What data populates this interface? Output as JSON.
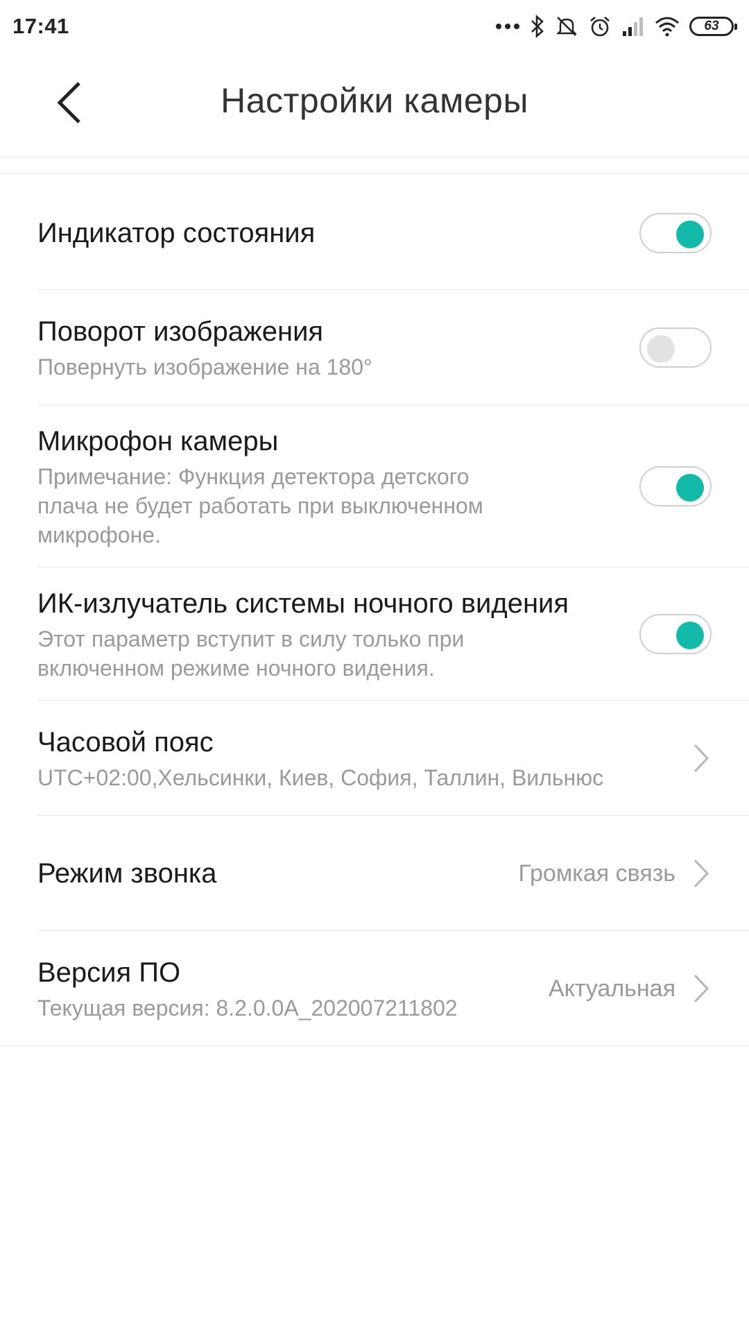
{
  "status_bar": {
    "time": "17:41",
    "battery_level": "63",
    "icons": [
      "more-dots-icon",
      "bluetooth-icon",
      "mute-icon",
      "alarm-icon",
      "signal-icon",
      "wifi-icon",
      "battery-icon"
    ]
  },
  "header": {
    "title": "Настройки камеры",
    "back_icon": "chevron-left-icon"
  },
  "colors": {
    "accent": "#13b9a9",
    "toggle_off_knob": "#e2e2e2",
    "subtitle": "#9a9a9a"
  },
  "settings": {
    "status_indicator": {
      "title": "Индикатор состояния",
      "enabled": true
    },
    "image_rotation": {
      "title": "Поворот изображения",
      "subtitle": "Повернуть изображение на 180°",
      "enabled": false
    },
    "camera_mic": {
      "title": "Микрофон камеры",
      "subtitle_line1": "Примечание: Функция детектора детского",
      "subtitle_line2": "плача не будет работать при выключенном",
      "subtitle_line3": "микрофоне.",
      "enabled": true
    },
    "ir_emitter": {
      "title": "ИК-излучатель системы ночного видения",
      "subtitle_line1": "Этот параметр вступит в силу только при",
      "subtitle_line2": "включенном режиме ночного видения.",
      "enabled": true
    },
    "timezone": {
      "title": "Часовой пояс",
      "subtitle": "UTC+02:00,Хельсинки, Киев, София, Таллин, Вильнюс"
    },
    "ring_mode": {
      "title": "Режим звонка",
      "value": "Громкая связь"
    },
    "firmware": {
      "title": "Версия ПО",
      "subtitle": "Текущая версия: 8.2.0.0A_202007211802",
      "value": "Актуальная"
    }
  }
}
